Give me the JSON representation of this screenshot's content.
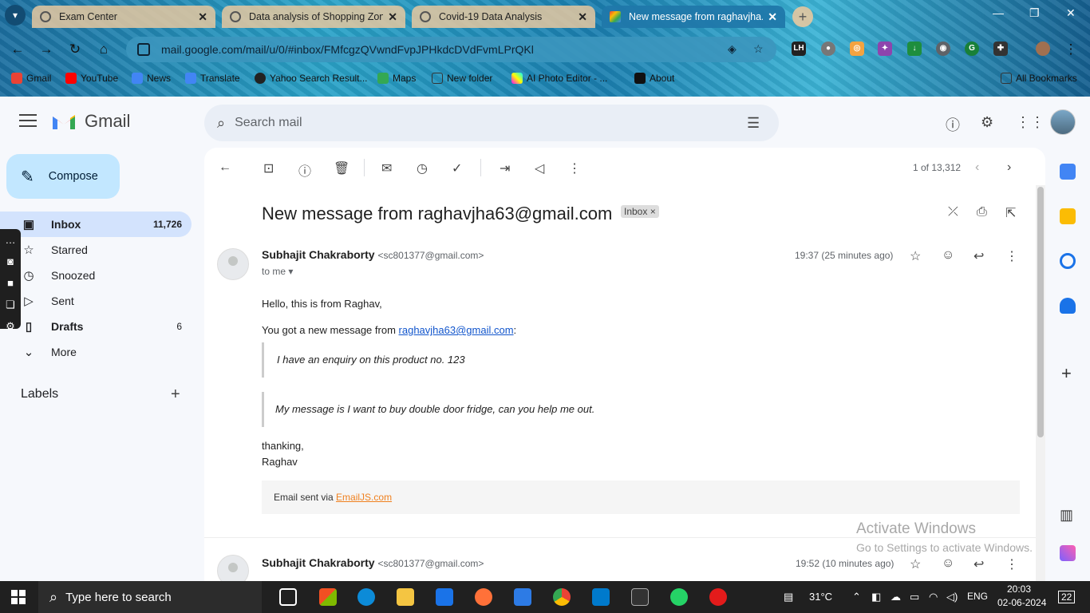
{
  "browser": {
    "tabs": [
      {
        "title": "Exam Center",
        "active": false
      },
      {
        "title": "Data analysis of Shopping Zone",
        "active": false
      },
      {
        "title": "Covid-19 Data Analysis",
        "active": false
      },
      {
        "title": "New message from raghavjha...",
        "active": true
      }
    ],
    "url": "mail.google.com/mail/u/0/#inbox/FMfcgzQVwndFvpJPHkdcDVdFvmLPrQKl",
    "bookmarks": [
      "Gmail",
      "YouTube",
      "News",
      "Translate",
      "Yahoo Search Result...",
      "Maps",
      "New folder",
      "AI Photo Editor - ...",
      "About"
    ],
    "all_bookmarks": "All Bookmarks"
  },
  "gmail": {
    "brand": "Gmail",
    "search_placeholder": "Search mail",
    "compose": "Compose",
    "nav": [
      {
        "label": "Inbox",
        "count": "11,726",
        "active": true,
        "icon": "inbox-icon"
      },
      {
        "label": "Starred",
        "count": "",
        "active": false,
        "icon": "star-icon"
      },
      {
        "label": "Snoozed",
        "count": "",
        "active": false,
        "icon": "clock-icon"
      },
      {
        "label": "Sent",
        "count": "",
        "active": false,
        "icon": "send-icon"
      },
      {
        "label": "Drafts",
        "count": "6",
        "active": false,
        "icon": "draft-icon"
      },
      {
        "label": "More",
        "count": "",
        "active": false,
        "icon": "chevron-down-icon"
      }
    ],
    "labels_title": "Labels",
    "pager": "1 of 13,312",
    "subject": "New message from raghavjha63@gmail.com",
    "badge": "Inbox",
    "message": {
      "sender": "Subhajit Chakraborty",
      "sender_email": "<sc801377@gmail.com>",
      "time": "19:37 (25 minutes ago)",
      "to": "to me",
      "greeting": "Hello, this is from Raghav,",
      "line_prefix": "You got a new message from",
      "line_link": "raghavjha63@gmail.com",
      "line_suffix": ":",
      "quote1": "I have an enquiry on this product no. 123",
      "quote2": "My message is I want to buy double door fridge, can you help me out.",
      "closing1": "thanking,",
      "closing2": "Raghav",
      "footer_prefix": "Email sent via",
      "footer_link": "EmailJS.com"
    },
    "message2": {
      "sender": "Subhajit Chakraborty",
      "sender_email": "<sc801377@gmail.com>",
      "time": "19:52 (10 minutes ago)"
    }
  },
  "watermark": {
    "title": "Activate Windows",
    "subtitle": "Go to Settings to activate Windows."
  },
  "taskbar": {
    "search_placeholder": "Type here to search",
    "weather": "31°C",
    "lang": "ENG",
    "time": "20:03",
    "date": "02-06-2024",
    "notifications": "22"
  }
}
